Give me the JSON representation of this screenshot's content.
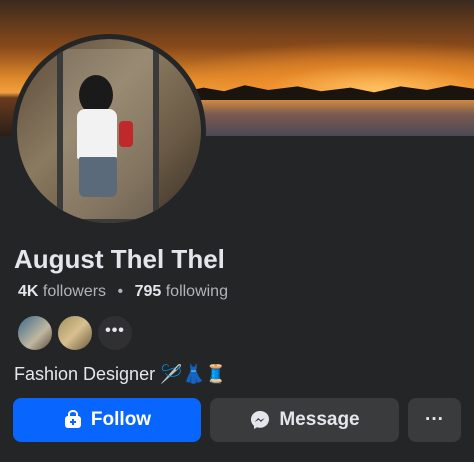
{
  "profile": {
    "name": "August Thel Thel",
    "followers_count": "4K",
    "followers_label": "followers",
    "separator": "•",
    "following_count": "795",
    "following_label": "following",
    "bio": "Fashion Designer 🪡👗🧵",
    "mutual_more": "•••"
  },
  "actions": {
    "follow_label": "Follow",
    "message_label": "Message",
    "more_label": "···"
  },
  "colors": {
    "background": "#242526",
    "primary": "#0866ff",
    "secondary_button": "#3a3b3c",
    "text": "#e4e6eb",
    "muted_text": "#b0b3b8"
  },
  "icons": {
    "follow": "user-plus-icon",
    "message": "messenger-icon",
    "more": "more-horizontal-icon"
  }
}
